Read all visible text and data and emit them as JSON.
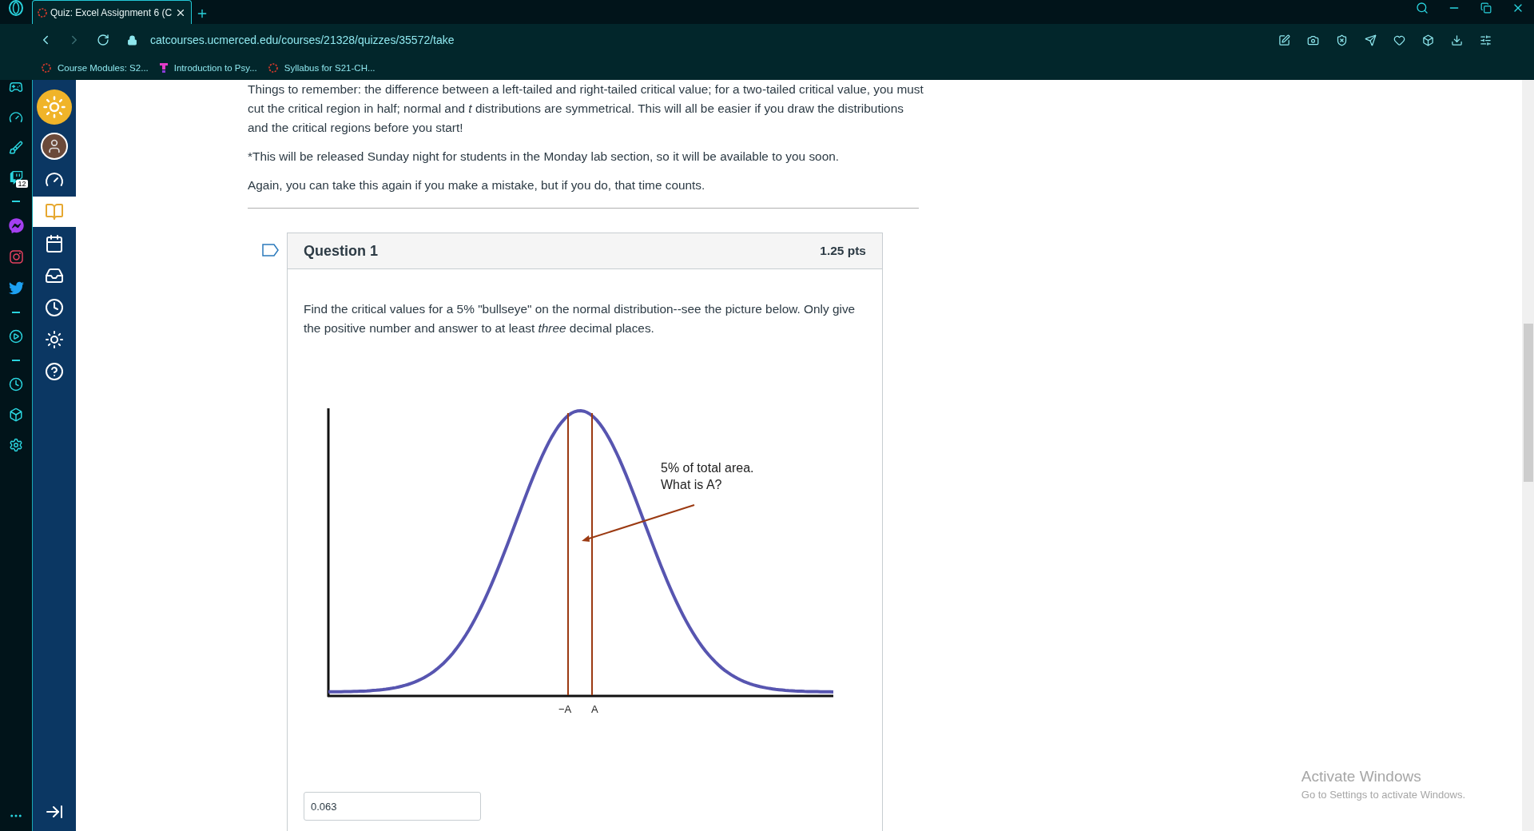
{
  "browser": {
    "tab": {
      "title": "Quiz: Excel Assignment 6 (C",
      "selected": true
    },
    "url": "catcourses.ucmerced.edu/courses/21328/quizzes/35572/take",
    "bookmarks": [
      {
        "label": "Course Modules: S2...",
        "kind": "canvas"
      },
      {
        "label": "Introduction to Psy...",
        "kind": "tophat"
      },
      {
        "label": "Syllabus for S21-CH...",
        "kind": "canvas"
      }
    ]
  },
  "side_panel": {
    "badge": "12"
  },
  "course_nav": [
    {
      "kind": "dashboard",
      "selected": false
    },
    {
      "kind": "courses",
      "selected": true
    },
    {
      "kind": "calendar",
      "selected": false
    },
    {
      "kind": "inbox",
      "selected": false
    },
    {
      "kind": "history",
      "selected": false
    },
    {
      "kind": "studio",
      "selected": false
    },
    {
      "kind": "help",
      "selected": false
    }
  ],
  "intro": [
    "Things to remember:  the difference between a left-tailed and right-tailed critical value; for a two-tailed critical value, you must cut the critical region in half; normal and *t* distributions are symmetrical.  This will all be easier if you draw the distributions and the critical regions before you start!",
    "*This will be released Sunday night for students in the Monday lab section, so it will be available to you soon.",
    "Again, you can take this again if you make a mistake, but if you do, that time counts."
  ],
  "question": {
    "title": "Question 1",
    "points": "1.25 pts",
    "flagged": false,
    "text": "Find the critical values for a 5% \"bullseye\" on the normal distribution--see the picture below.  Only give the positive number and answer to at least *three* decimal places.",
    "figure": {
      "callout": [
        "5% of total area.",
        "What is A?"
      ],
      "left_label": "−A",
      "right_label": "A"
    },
    "answer": "0.063"
  },
  "activation": {
    "title": "Activate Windows",
    "subtitle": "Go to Settings to activate Windows."
  }
}
